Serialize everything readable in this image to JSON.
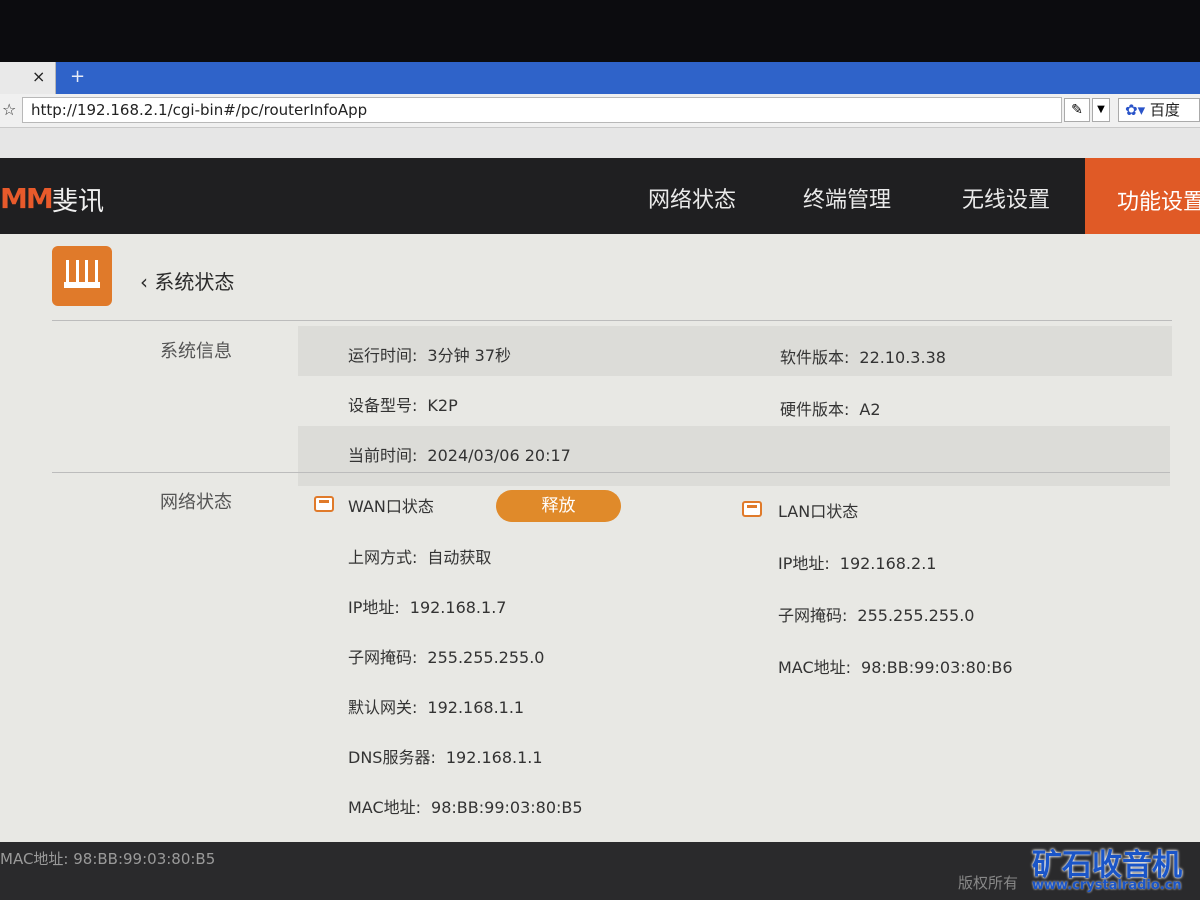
{
  "browser": {
    "tab_close": "×",
    "new_tab": "+",
    "url": "http://192.168.2.1/cgi-bin#/pc/routerInfoApp",
    "search_engine": "百度"
  },
  "header": {
    "logo_mark": "MM",
    "logo_text": "斐讯",
    "nav": [
      "网络状态",
      "终端管理",
      "无线设置",
      "功能设置"
    ],
    "active_color": "#e05a26"
  },
  "page": {
    "title": "系统状态"
  },
  "system_info": {
    "label": "系统信息",
    "uptime_label": "运行时间:",
    "uptime": "3分钟 37秒",
    "sw_label": "软件版本:",
    "sw": "22.10.3.38",
    "model_label": "设备型号:",
    "model": "K2P",
    "hw_label": "硬件版本:",
    "hw": "A2",
    "time_label": "当前时间:",
    "time": "2024/03/06 20:17"
  },
  "network": {
    "label": "网络状态",
    "wan": {
      "title": "WAN口状态",
      "release": "释放",
      "mode_label": "上网方式:",
      "mode": "自动获取",
      "ip_label": "IP地址:",
      "ip": "192.168.1.7",
      "mask_label": "子网掩码:",
      "mask": "255.255.255.0",
      "gw_label": "默认网关:",
      "gw": "192.168.1.1",
      "dns_label": "DNS服务器:",
      "dns": "192.168.1.1",
      "mac_label": "MAC地址:",
      "mac": "98:BB:99:03:80:B5"
    },
    "lan": {
      "title": "LAN口状态",
      "ip_label": "IP地址:",
      "ip": "192.168.2.1",
      "mask_label": "子网掩码:",
      "mask": "255.255.255.0",
      "mac_label": "MAC地址:",
      "mac": "98:BB:99:03:80:B6"
    }
  },
  "footer": {
    "mac_text": "MAC地址: 98:BB:99:03:80:B5",
    "copyright": "版权所有"
  },
  "watermark": {
    "main": "矿石收音机",
    "url": "www.crystalradio.cn"
  }
}
